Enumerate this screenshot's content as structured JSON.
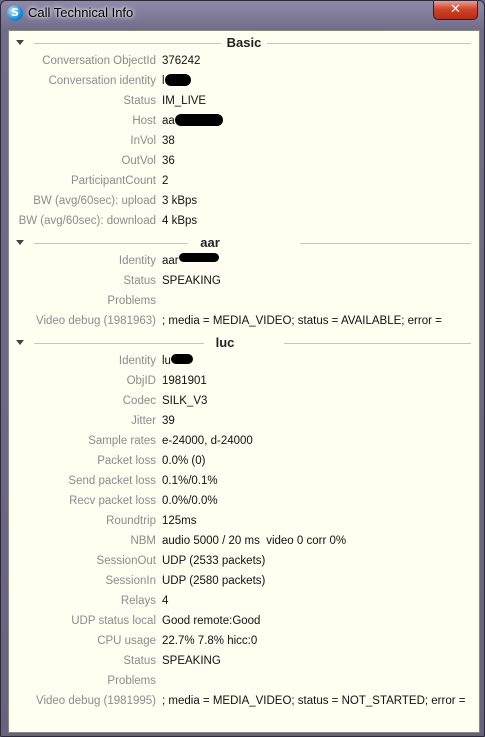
{
  "window": {
    "title": "Call Technical Info",
    "close_label": "✕",
    "app_icon": "skype-icon"
  },
  "sections": {
    "basic": {
      "title": "Basic",
      "rows": [
        {
          "label": "Conversation ObjectId",
          "value": "376242"
        },
        {
          "label": "Conversation identity",
          "value": "l"
        },
        {
          "label": "Status",
          "value": "IM_LIVE"
        },
        {
          "label": "Host",
          "value": "aa"
        },
        {
          "label": "InVol",
          "value": "38"
        },
        {
          "label": "OutVol",
          "value": "36"
        },
        {
          "label": "ParticipantCount",
          "value": "2"
        },
        {
          "label": "BW (avg/60sec): upload",
          "value": "3 kBps"
        },
        {
          "label": "BW (avg/60sec): download",
          "value": "4 kBps"
        }
      ]
    },
    "participant1": {
      "title": "aar",
      "rows": [
        {
          "label": "Identity",
          "value": "aar"
        },
        {
          "label": "Status",
          "value": "SPEAKING"
        },
        {
          "label": "Problems",
          "value": ""
        },
        {
          "label": "Video debug (1981963)",
          "value": "; media = MEDIA_VIDEO; status = AVAILABLE; error ="
        }
      ]
    },
    "participant2": {
      "title": "luc",
      "rows": [
        {
          "label": "Identity",
          "value": "lu"
        },
        {
          "label": "ObjID",
          "value": "1981901"
        },
        {
          "label": "Codec",
          "value": "SILK_V3"
        },
        {
          "label": "Jitter",
          "value": "39"
        },
        {
          "label": "Sample rates",
          "value": "e-24000, d-24000"
        },
        {
          "label": "Packet loss",
          "value": "0.0% (0)"
        },
        {
          "label": "Send packet loss",
          "value": "0.1%/0.1%"
        },
        {
          "label": "Recv packet loss",
          "value": "0.0%/0.0%"
        },
        {
          "label": "Roundtrip",
          "value": "125ms"
        },
        {
          "label": "NBM",
          "value": "audio 5000 / 20 ms  video 0 corr 0%"
        },
        {
          "label": "SessionOut",
          "value": "UDP (2533 packets)"
        },
        {
          "label": "SessionIn",
          "value": "UDP (2580 packets)"
        },
        {
          "label": "Relays",
          "value": "4"
        },
        {
          "label": "UDP status local",
          "value": "Good remote:Good"
        },
        {
          "label": "CPU usage",
          "value": "22.7% 7.8% hicc:0"
        },
        {
          "label": "Status",
          "value": "SPEAKING"
        },
        {
          "label": "Problems",
          "value": ""
        },
        {
          "label": "Video debug (1981995)",
          "value": "; media = MEDIA_VIDEO; status = NOT_STARTED; error ="
        }
      ]
    }
  }
}
